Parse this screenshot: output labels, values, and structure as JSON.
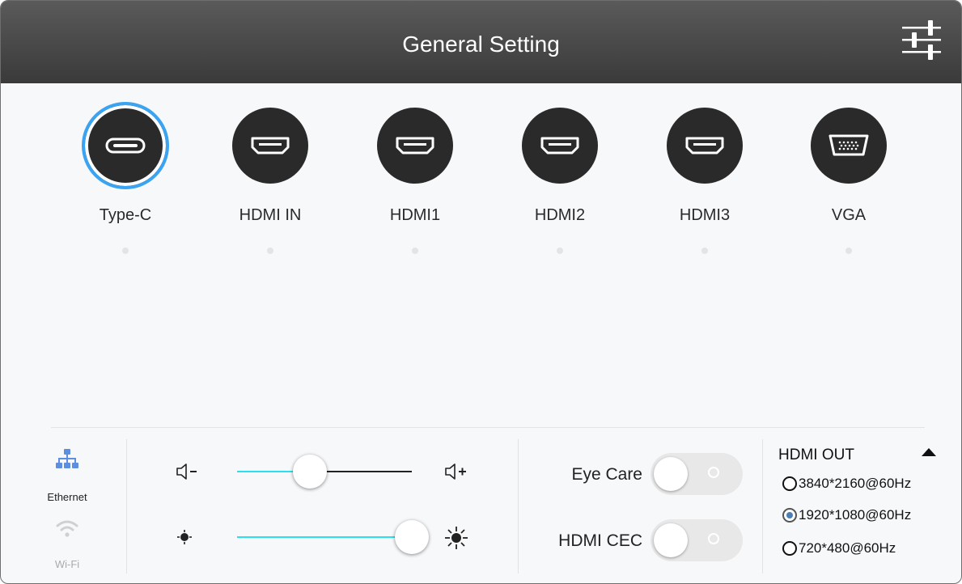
{
  "header": {
    "title": "General Setting",
    "settings_icon": "sliders-icon"
  },
  "sources": [
    {
      "label": "Type-C",
      "icon": "usb-c-icon",
      "selected": true
    },
    {
      "label": "HDMI IN",
      "icon": "hdmi-icon",
      "selected": false
    },
    {
      "label": "HDMI1",
      "icon": "hdmi-icon",
      "selected": false
    },
    {
      "label": "HDMI2",
      "icon": "hdmi-icon",
      "selected": false
    },
    {
      "label": "HDMI3",
      "icon": "hdmi-icon",
      "selected": false
    },
    {
      "label": "VGA",
      "icon": "vga-icon",
      "selected": false
    }
  ],
  "network": {
    "ethernet_label": "Ethernet",
    "wifi_label": "Wi-Fi",
    "active": "ethernet"
  },
  "volume": {
    "icon_down": "volume-down-icon",
    "icon_up": "volume-up-icon",
    "level": 0.4
  },
  "brightness": {
    "icon_low": "brightness-low-icon",
    "icon_high": "brightness-high-icon",
    "level": 1.0
  },
  "toggles": {
    "eye_care": {
      "label": "Eye Care",
      "on": false
    },
    "hdmi_cec": {
      "label": "HDMI CEC",
      "on": false
    }
  },
  "hdmi_out": {
    "title": "HDMI OUT",
    "options": [
      {
        "label": "3840*2160@60Hz",
        "selected": false
      },
      {
        "label": "1920*1080@60Hz",
        "selected": true
      },
      {
        "label": "720*480@60Hz",
        "selected": false
      }
    ]
  },
  "colors": {
    "accent": "#3aa3f2",
    "track": "#29e0f0",
    "header": "#474747"
  }
}
